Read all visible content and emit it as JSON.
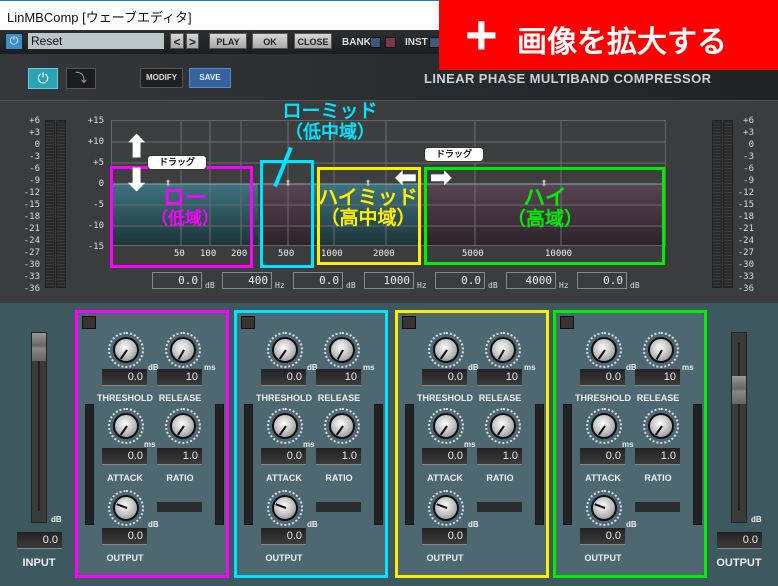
{
  "window": {
    "title": "LinMBComp [ウェーブエディタ]"
  },
  "toolbar": {
    "preset": "Reset",
    "prev": "<",
    "next": ">",
    "play": "PLAY",
    "ok": "OK",
    "close": "CLOSE",
    "bank": "BANK",
    "inst": "INST"
  },
  "banner": {
    "plus": "+",
    "text": "画像を拡大する",
    "color": "#ff0000"
  },
  "header": {
    "modify": "MODIFY",
    "save": "SAVE",
    "title": "LINEAR PHASE MULTIBAND COMPRESSOR"
  },
  "meter_scale": [
    "+6",
    "+3",
    "0",
    "-3",
    "-6",
    "-9",
    "-12",
    "-15",
    "-18",
    "-21",
    "-24",
    "-27",
    "-30",
    "-33",
    "-36"
  ],
  "graph": {
    "db_ticks": [
      "+15",
      "+10",
      "+5",
      "0",
      "-5",
      "-10",
      "-15"
    ],
    "freq_ticks": [
      "50",
      "100",
      "200",
      "500",
      "1000",
      "2000",
      "5000",
      "10000"
    ],
    "values": [
      {
        "v": "0.0",
        "u": "dB"
      },
      {
        "v": "400",
        "u": "Hz"
      },
      {
        "v": "0.0",
        "u": "dB"
      },
      {
        "v": "1000",
        "u": "Hz"
      },
      {
        "v": "0.0",
        "u": "dB"
      },
      {
        "v": "4000",
        "u": "Hz"
      },
      {
        "v": "0.0",
        "u": "dB"
      }
    ]
  },
  "annotations": {
    "drag": "ドラッグ",
    "low": [
      "ロー",
      "（低域）"
    ],
    "lowmid": [
      "ローミッド",
      "（低中域）"
    ],
    "himid": [
      "ハイミッド",
      "（高中域）"
    ],
    "high": [
      "ハイ",
      "（高域）"
    ],
    "colors": {
      "low": "#ff00ff",
      "lowmid": "#00e5ff",
      "himid": "#ffee00",
      "high": "#00ee00"
    }
  },
  "labels": {
    "threshold": "THRESHOLD",
    "release": "RELEASE",
    "attack": "ATTACK",
    "ratio": "RATIO",
    "output": "OUTPUT",
    "db": "dB",
    "ms": "ms"
  },
  "bands": [
    {
      "id": "low",
      "color": "#ff00ff",
      "threshold": "0.0",
      "release": "10",
      "attack": "0.0",
      "ratio": "1.0",
      "output": "0.0"
    },
    {
      "id": "lowmid",
      "color": "#00e5ff",
      "threshold": "0.0",
      "release": "10",
      "attack": "0.0",
      "ratio": "1.0",
      "output": "0.0"
    },
    {
      "id": "himid",
      "color": "#ffee00",
      "threshold": "0.0",
      "release": "10",
      "attack": "0.0",
      "ratio": "1.0",
      "output": "0.0"
    },
    {
      "id": "high",
      "color": "#00ee00",
      "threshold": "0.0",
      "release": "10",
      "attack": "0.0",
      "ratio": "1.0",
      "output": "0.0"
    }
  ],
  "input": {
    "label": "INPUT",
    "value": "0.0",
    "unit": "dB"
  },
  "output": {
    "label": "OUTPUT",
    "value": "0.0",
    "unit": "dB"
  }
}
